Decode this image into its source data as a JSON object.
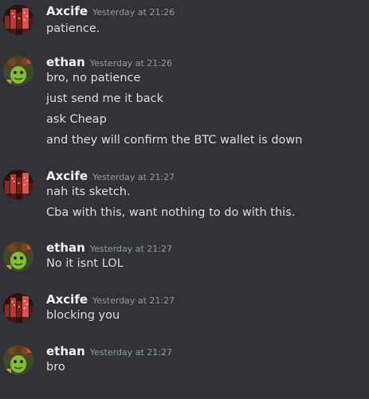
{
  "messages": [
    {
      "username": "Axcife",
      "avatar_icon": "axcife-city-avatar-icon",
      "timestamp": "Yesterday at 21:26",
      "lines": [
        "patience."
      ]
    },
    {
      "username": "ethan",
      "avatar_icon": "ethan-green-face-avatar-icon",
      "timestamp": "Yesterday at 21:26",
      "lines": [
        "bro, no patience",
        "just send me it back",
        "ask Cheap",
        "and they will confirm the BTC wallet is down"
      ]
    },
    {
      "username": "Axcife",
      "avatar_icon": "axcife-city-avatar-icon",
      "timestamp": "Yesterday at 21:27",
      "lines": [
        "nah its sketch.",
        "Cba with this, want nothing to do with this."
      ]
    },
    {
      "username": "ethan",
      "avatar_icon": "ethan-green-face-avatar-icon",
      "timestamp": "Yesterday at 21:27",
      "lines": [
        "No it isnt LOL"
      ]
    },
    {
      "username": "Axcife",
      "avatar_icon": "axcife-city-avatar-icon",
      "timestamp": "Yesterday at 21:27",
      "lines": [
        "blocking you"
      ]
    },
    {
      "username": "ethan",
      "avatar_icon": "ethan-green-face-avatar-icon",
      "timestamp": "Yesterday at 21:27",
      "lines": [
        "bro"
      ]
    }
  ],
  "colors": {
    "background": "#313338",
    "username": "#f2f3f5",
    "timestamp": "#949ba4",
    "message_text": "#dbdee1"
  }
}
